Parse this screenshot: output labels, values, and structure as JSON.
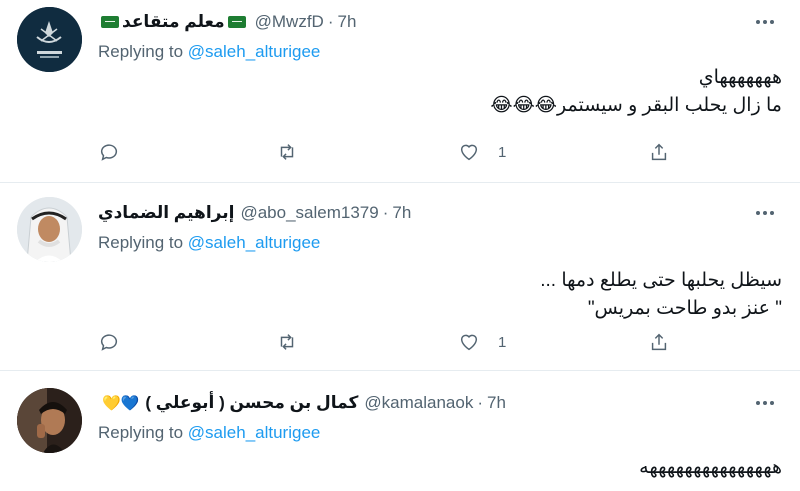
{
  "tweets": [
    {
      "name": "معلم متقاعد",
      "handle": "@MwzfD",
      "time": "7h",
      "replying_prefix": "Replying to",
      "replying_to": "@saleh_alturigee",
      "lines": [
        "هههههههاي",
        "ما زال يحلب البقر و سيستمر😂😂😂"
      ],
      "like_count": "1"
    },
    {
      "name": "إبراهيم الضمادي",
      "handle": "@abo_salem1379",
      "time": "7h",
      "replying_prefix": "Replying to",
      "replying_to": "@saleh_alturigee",
      "lines": [
        "سيظل يحلبها حتى يطلع دمها ...",
        "\" عنز بدو طاحت بمريس\""
      ],
      "like_count": "1"
    },
    {
      "name": "كمال بن محسن ( أبوعلي )",
      "name_emoji": "💛💙",
      "handle": "@kamalanaok",
      "time": "7h",
      "replying_prefix": "Replying to",
      "replying_to": "@saleh_alturigee",
      "lines": [
        "هههههههههههههههه"
      ]
    }
  ],
  "icons": {
    "reply": "reply-icon",
    "retweet": "retweet-icon",
    "like": "heart-icon",
    "share": "share-icon",
    "more": "more-icon"
  },
  "colors": {
    "link": "#1d9bf0",
    "secondary_text": "#536471",
    "divider": "#e6ecf0"
  }
}
